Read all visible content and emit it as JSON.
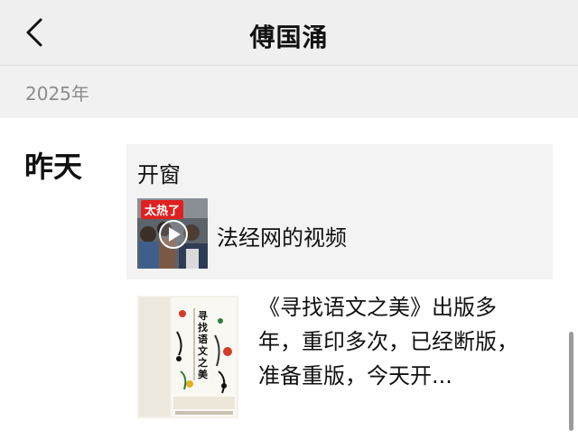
{
  "header": {
    "title": "傅国涌",
    "back_icon": "chevron-left-icon"
  },
  "timeline": {
    "year": "2025年",
    "day_label": "昨天"
  },
  "posts": [
    {
      "text": "开窗",
      "video": {
        "thumbnail_badge": "太热了",
        "caption": "法经网的视频",
        "play_icon": "play-icon"
      }
    },
    {
      "text": "《寻找语文之美》出版多年，重印多次，已经断版，准备重版，今天开...",
      "thumbnail_title": "寻找语文之美"
    }
  ]
}
